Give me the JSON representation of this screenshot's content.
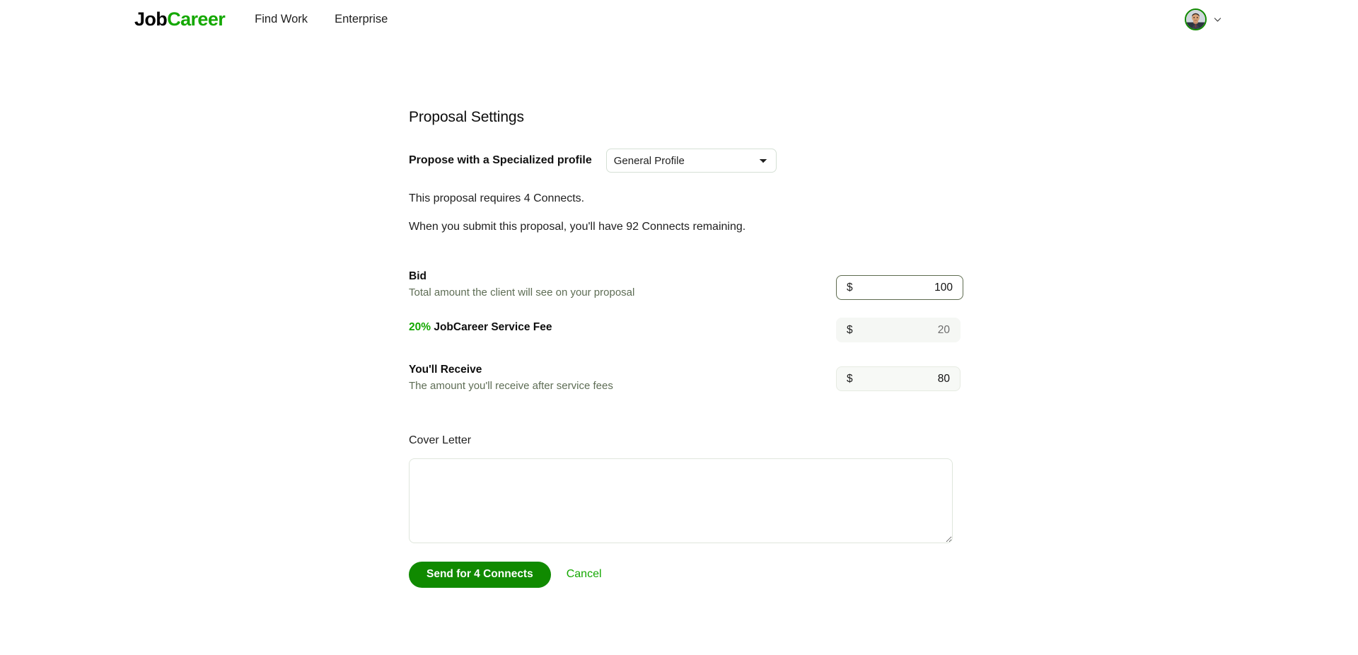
{
  "header": {
    "brand": {
      "part1": "Job",
      "part2": "Career",
      "accent_color": "#14a800"
    },
    "nav": [
      {
        "label": "Find Work"
      },
      {
        "label": "Enterprise"
      }
    ],
    "account": {
      "avatar_alt": "user-avatar",
      "ring_color": "#108a00",
      "chevron": "chevron-down-icon"
    }
  },
  "panel": {
    "title": "Proposal Settings",
    "profile": {
      "label": "Propose with a Specialized profile",
      "selected": "General Profile",
      "options": [
        "General Profile"
      ]
    },
    "connects": {
      "required_line": "This proposal requires 4 Connects.",
      "remaining_line": "When you submit this proposal, you'll have 92 Connects remaining."
    },
    "money": {
      "bid": {
        "title": "Bid",
        "subtitle": "Total amount the client will see on your proposal",
        "currency": "$",
        "value": "100"
      },
      "fee": {
        "percent": "20%",
        "title": " JobCareer Service Fee",
        "currency": "$",
        "value": "20"
      },
      "receive": {
        "title": "You'll Receive",
        "subtitle": "The amount you'll receive after service fees",
        "currency": "$",
        "value": "80"
      }
    },
    "cover_letter": {
      "label": "Cover Letter",
      "value": "",
      "placeholder": ""
    },
    "actions": {
      "submit_label": "Send for 4 Connects",
      "cancel_label": "Cancel",
      "submit_color": "#108a00",
      "cancel_color": "#14a800"
    }
  }
}
